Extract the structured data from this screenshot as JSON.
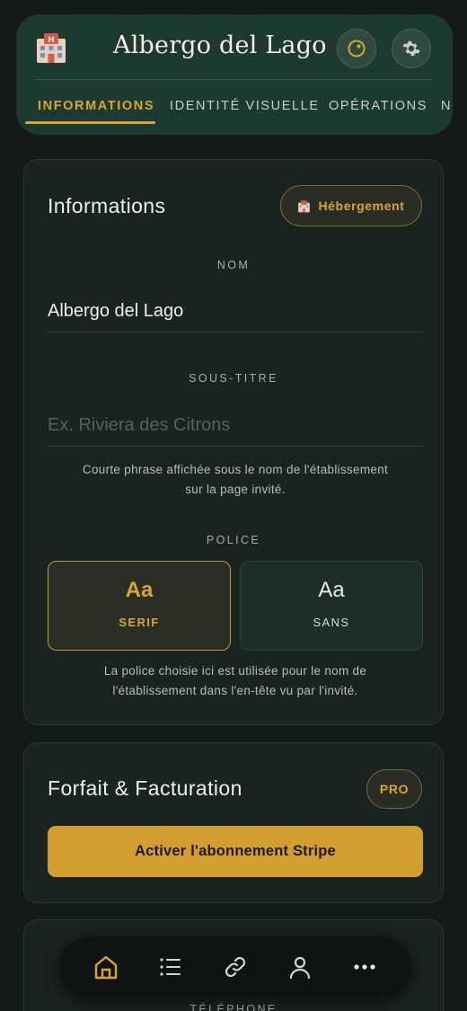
{
  "header": {
    "title": "Albergo del Lago",
    "icons": {
      "logo": "hotel-icon",
      "theme": "theme-toggle-icon",
      "settings": "gear-icon"
    },
    "tabs": [
      {
        "label": "INFORMATIONS",
        "active": true
      },
      {
        "label": "IDENTITÉ VISUELLE",
        "active": false
      },
      {
        "label": "OPÉRATIONS",
        "active": false
      },
      {
        "label": "NO",
        "active": false
      }
    ]
  },
  "info_card": {
    "title": "Informations",
    "badge": "Hébergement",
    "badge_icon": "hotel-icon",
    "name_label": "NOM",
    "name_value": "Albergo del Lago",
    "subtitle_label": "SOUS-TITRE",
    "subtitle_placeholder": "Ex. Riviera des Citrons",
    "subtitle_help_line1": "Courte phrase affichée sous le nom de l'établissement",
    "subtitle_help_line2": "sur la page invité.",
    "font_label": "POLICE",
    "font_options": [
      {
        "sample": "Aa",
        "name": "SERIF",
        "selected": true
      },
      {
        "sample": "Aa",
        "name": "SANS",
        "selected": false
      }
    ],
    "font_help_line1": "La police choisie ici est utilisée pour le nom de",
    "font_help_line2": "l'établissement dans l'en-tête vu par l'invité."
  },
  "plan_card": {
    "title": "Forfait & Facturation",
    "badge": "PRO",
    "cta_label": "Activer l'abonnement Stripe"
  },
  "next_card": {
    "field_label": "TÉLÉPHONE"
  },
  "bottom_nav": [
    {
      "icon": "home-icon",
      "active": true
    },
    {
      "icon": "list-icon",
      "active": false
    },
    {
      "icon": "link-icon",
      "active": false
    },
    {
      "icon": "user-icon",
      "active": false
    },
    {
      "icon": "more-icon",
      "active": false
    }
  ],
  "colors": {
    "accent": "#d9a633",
    "header_bg": "#1d3a31",
    "card_bg": "#19231f",
    "page_bg": "#141a18"
  }
}
